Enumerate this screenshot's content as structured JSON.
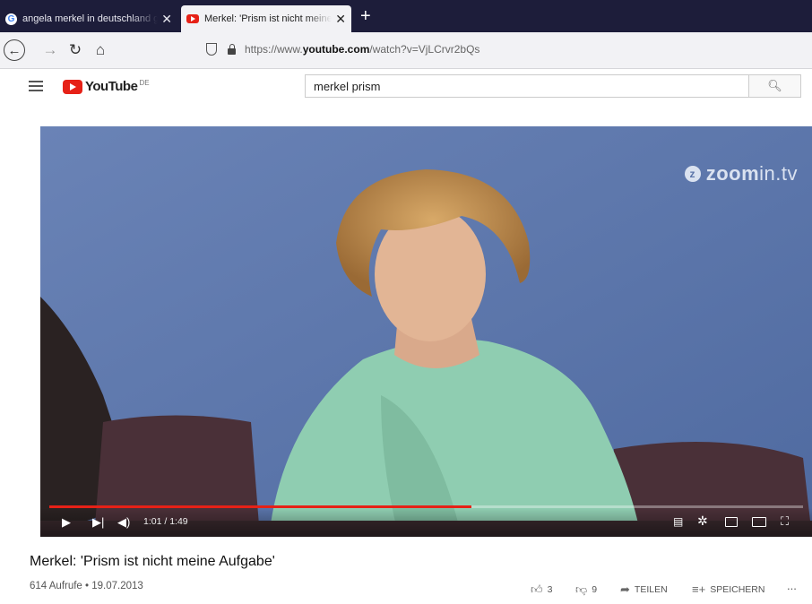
{
  "browser": {
    "tabs": [
      {
        "title": "angela merkel in deutschland g",
        "favicon": "google-favicon-icon",
        "active": false
      },
      {
        "title": "Merkel: 'Prism ist nicht meine A",
        "favicon": "youtube-favicon-icon",
        "active": true
      }
    ],
    "new_tab_label": "+",
    "url_prefix": "https://www.",
    "url_domain": "youtube.com",
    "url_path": "/watch?v=VjLCrvr2bQs"
  },
  "youtube": {
    "logo_text": "YouTube",
    "country_code": "DE",
    "search_value": "merkel prism"
  },
  "video": {
    "watermark_bold": "zoom",
    "watermark_light": "in.tv",
    "current_time": "1:01",
    "duration": "1:49",
    "time_display": "1:01 / 1:49",
    "progress_fraction": 0.56,
    "title": "Merkel: 'Prism ist nicht meine Aufgabe'",
    "meta": "614 Aufrufe • 19.07.2013",
    "likes": "3",
    "dislikes": "9",
    "share_label": "TEILEN",
    "save_label": "SPEICHERN",
    "more_label": "..."
  },
  "colors": {
    "tab_strip": "#1d1d3a",
    "youtube_red": "#e62117",
    "video_background": "#5b74a8"
  }
}
